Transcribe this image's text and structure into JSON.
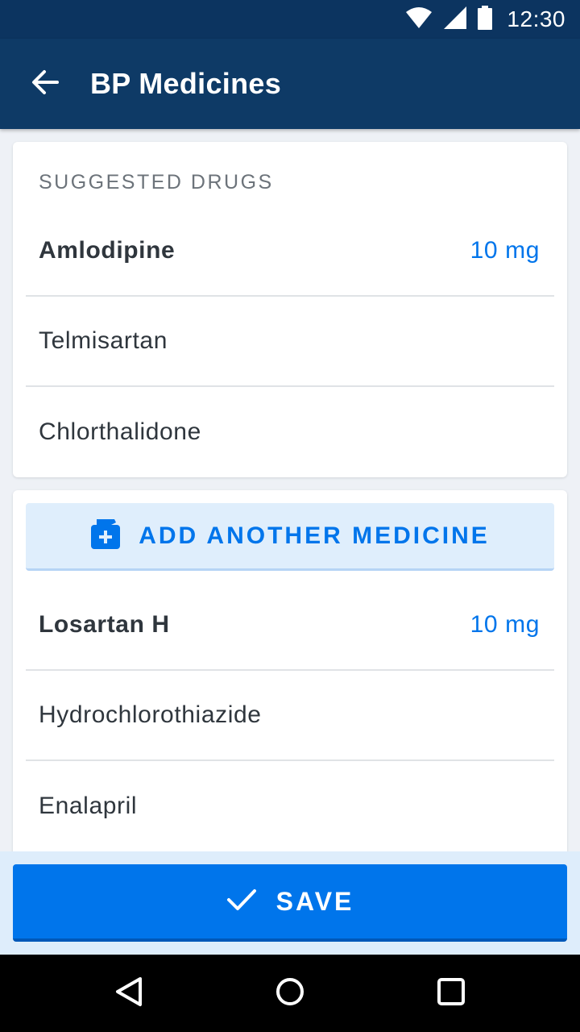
{
  "status_bar": {
    "time": "12:30",
    "icons": [
      "wifi-icon",
      "signal-icon",
      "battery-icon"
    ]
  },
  "app_bar": {
    "title": "BP Medicines",
    "back_icon": "arrow-back-icon"
  },
  "suggested": {
    "section_title": "SUGGESTED DRUGS",
    "drugs": [
      {
        "name": "Amlodipine",
        "dose": "10 mg",
        "selected": true
      },
      {
        "name": "Telmisartan",
        "dose": "",
        "selected": false
      },
      {
        "name": "Chlorthalidone",
        "dose": "",
        "selected": false
      }
    ]
  },
  "custom": {
    "add_button_label": "ADD ANOTHER MEDICINE",
    "add_button_icon": "medicine-bottle-plus-icon",
    "drugs": [
      {
        "name": "Losartan H",
        "dose": "10 mg",
        "selected": true
      },
      {
        "name": "Hydrochlorothiazide",
        "dose": "",
        "selected": false
      },
      {
        "name": "Enalapril",
        "dose": "",
        "selected": false
      }
    ]
  },
  "footer": {
    "save_label": "SAVE",
    "save_icon": "check-icon"
  },
  "nav_bar": {
    "buttons": [
      "back-triangle-icon",
      "home-circle-icon",
      "recents-square-icon"
    ]
  },
  "colors": {
    "status_bar": "#0c3460",
    "app_bar": "#0e3a66",
    "accent": "#0075eb",
    "add_button_bg": "#dfeefc",
    "footer_bg": "#deedfb"
  }
}
